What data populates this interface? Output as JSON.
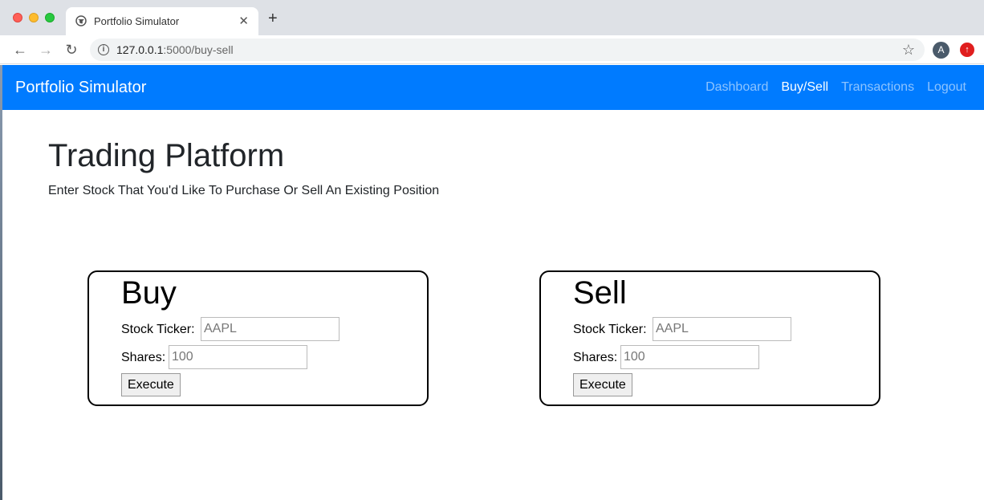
{
  "browser": {
    "tab_title": "Portfolio Simulator",
    "url_host": "127.0.0.1",
    "url_path": ":5000/buy-sell",
    "avatar_letter": "A"
  },
  "navbar": {
    "brand": "Portfolio Simulator",
    "links": [
      {
        "label": "Dashboard",
        "active": false
      },
      {
        "label": "Buy/Sell",
        "active": true
      },
      {
        "label": "Transactions",
        "active": false
      },
      {
        "label": "Logout",
        "active": false
      }
    ],
    "color": "#007bff"
  },
  "main": {
    "title": "Trading Platform",
    "subtitle": "Enter Stock That You'd Like To Purchase Or Sell An Existing Position"
  },
  "buy": {
    "title": "Buy",
    "ticker_label": "Stock Ticker:",
    "ticker_placeholder": "AAPL",
    "shares_label": "Shares:",
    "shares_placeholder": "100",
    "button": "Execute"
  },
  "sell": {
    "title": "Sell",
    "ticker_label": "Stock Ticker:",
    "ticker_placeholder": "AAPL",
    "shares_label": "Shares:",
    "shares_placeholder": "100",
    "button": "Execute"
  }
}
